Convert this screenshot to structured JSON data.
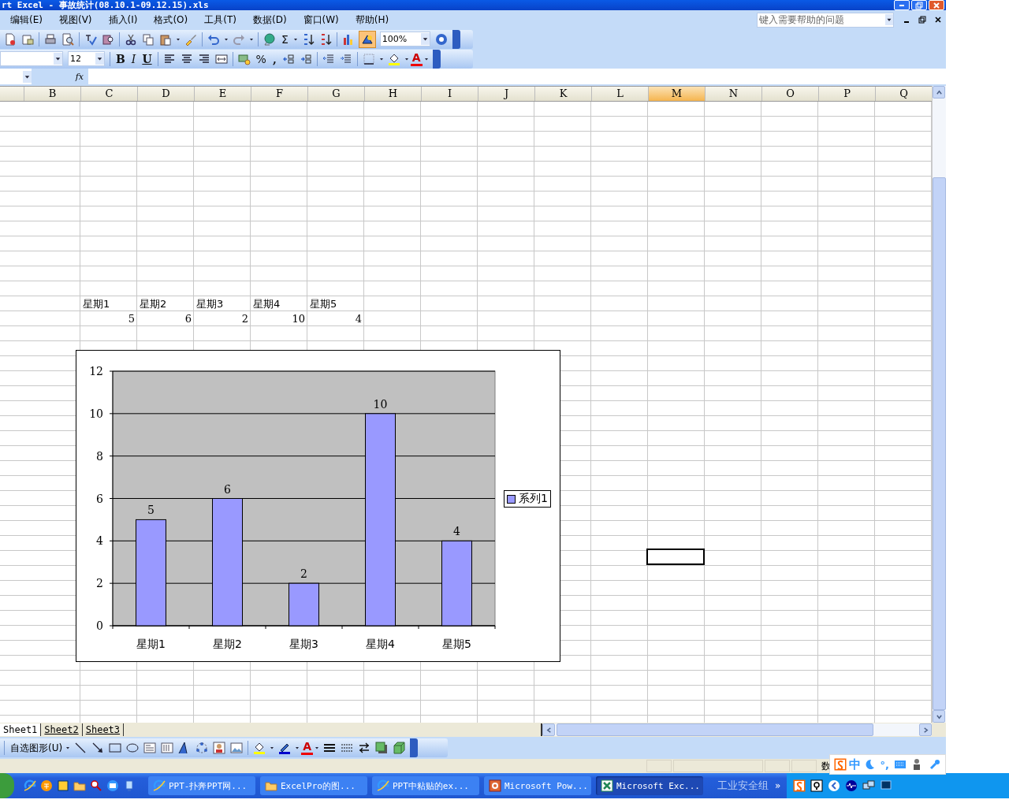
{
  "window": {
    "title": "rt Excel - 事故统计(08.10.1-09.12.15).xls"
  },
  "menu": [
    {
      "label": "编辑(E)"
    },
    {
      "label": "视图(V)"
    },
    {
      "label": "插入(I)"
    },
    {
      "label": "格式(O)"
    },
    {
      "label": "工具(T)"
    },
    {
      "label": "数据(D)"
    },
    {
      "label": "窗口(W)"
    },
    {
      "label": "帮助(H)"
    }
  ],
  "help_search": {
    "placeholder": "键入需要帮助的问题"
  },
  "standard_toolbar": {
    "autosum": "Σ",
    "zoom": "100%"
  },
  "formatting_toolbar": {
    "font_size": "12",
    "bold": "B",
    "italic": "I",
    "underline": "U",
    "percent": "%",
    "comma": ",",
    "font_color": "A"
  },
  "formula_bar": {
    "function_label": "fx"
  },
  "columns": [
    {
      "label": "B",
      "selected": false
    },
    {
      "label": "C",
      "selected": false
    },
    {
      "label": "D",
      "selected": false
    },
    {
      "label": "E",
      "selected": false
    },
    {
      "label": "F",
      "selected": false
    },
    {
      "label": "G",
      "selected": false
    },
    {
      "label": "H",
      "selected": false
    },
    {
      "label": "I",
      "selected": false
    },
    {
      "label": "J",
      "selected": false
    },
    {
      "label": "K",
      "selected": false
    },
    {
      "label": "L",
      "selected": false
    },
    {
      "label": "M",
      "selected": true
    },
    {
      "label": "N",
      "selected": false
    },
    {
      "label": "O",
      "selected": false
    },
    {
      "label": "P",
      "selected": false
    },
    {
      "label": "Q",
      "selected": false
    }
  ],
  "sheet_data": {
    "headers": [
      "星期1",
      "星期2",
      "星期3",
      "星期4",
      "星期5"
    ],
    "values": [
      "5",
      "6",
      "2",
      "10",
      "4"
    ]
  },
  "chart": {
    "chart_data": {
      "type": "bar",
      "grid": true,
      "categories": [
        "星期1",
        "星期2",
        "星期3",
        "星期4",
        "星期5"
      ],
      "series": [
        {
          "name": "系列1",
          "color": "#9999ff",
          "values": [
            5,
            6,
            2,
            10,
            4
          ]
        }
      ],
      "ylim": [
        0,
        12
      ],
      "yticks": [
        0,
        2,
        4,
        6,
        8,
        10,
        12
      ],
      "data_labels": true
    }
  },
  "sheet_tabs": [
    {
      "label": "Sheet1",
      "selected": true
    },
    {
      "label": "Sheet2",
      "selected": false
    },
    {
      "label": "Sheet3",
      "selected": false
    }
  ],
  "drawing_toolbar": {
    "autoshapes": "自选图形(U)",
    "font_color": "A"
  },
  "status_bar": {
    "indicator": "数"
  },
  "ime_bar": {
    "mode": "中",
    "punctuation": "°,"
  },
  "taskbar": {
    "tasks": [
      {
        "label": "PPT-扑奔PPT网...",
        "kind": "browser",
        "selected": false
      },
      {
        "label": "ExcelPro的图...",
        "kind": "folder",
        "selected": false
      },
      {
        "label": "PPT中粘贴的ex...",
        "kind": "browser",
        "selected": false
      },
      {
        "label": "Microsoft Pow...",
        "kind": "powerpoint",
        "selected": false
      },
      {
        "label": "Microsoft Exc...",
        "kind": "excel",
        "selected": true
      }
    ],
    "toolbar_label": "工业安全组",
    "more": "»"
  }
}
